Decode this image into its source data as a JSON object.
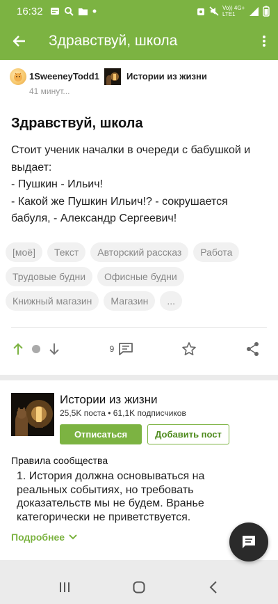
{
  "status_bar": {
    "time": "16:32",
    "network_label": "Vo)) 4G+ LTE1",
    "colors": {
      "bar": "#7cb342"
    }
  },
  "app_bar": {
    "title": "Здравствуй, школа",
    "back_icon": "arrow-left-icon",
    "more_icon": "more-vertical-icon"
  },
  "post": {
    "author": "1SweeneyTodd1",
    "community": "Истории из жизни",
    "time": "41 минут...",
    "title": "Здравствуй, школа",
    "body": [
      "Стоит ученик началки в очереди с бабушкой и выдает:",
      "- Пушкин - Ильич!",
      "- Какой же Пушкин Ильич!? - сокрушается бабуля, - Александр Сергеевич!"
    ],
    "tags": [
      "[моё]",
      "Текст",
      "Авторский рассказ",
      "Работа",
      "Трудовые будни",
      "Офисные будни",
      "Книжный магазин",
      "Магазин",
      "..."
    ],
    "actions": {
      "comment_count": "9",
      "upvote_icon": "arrow-up-icon",
      "downvote_icon": "arrow-down-icon",
      "comment_icon": "comment-icon",
      "save_icon": "star-icon",
      "share_icon": "share-icon"
    }
  },
  "community_card": {
    "name": "Истории из жизни",
    "stats": "25,5K поста • 61,1K подписчиков",
    "unsubscribe_label": "Отписаться",
    "add_post_label": "Добавить пост",
    "rules_title": "Правила сообщества",
    "rules_text": "1. История должна основываться на реальных событиях, но требовать доказательств мы не будем. Вранье категорически не приветствуется.",
    "more_label": "Подробнее"
  },
  "fab": {
    "icon": "chat-icon"
  },
  "nav_bar": {
    "icons": [
      "recents-icon",
      "home-icon",
      "back-icon"
    ]
  },
  "colors": {
    "accent": "#7cb342",
    "tag_bg": "#f1f1f1",
    "tag_text": "#888888",
    "fab": "#2a2a2a"
  }
}
